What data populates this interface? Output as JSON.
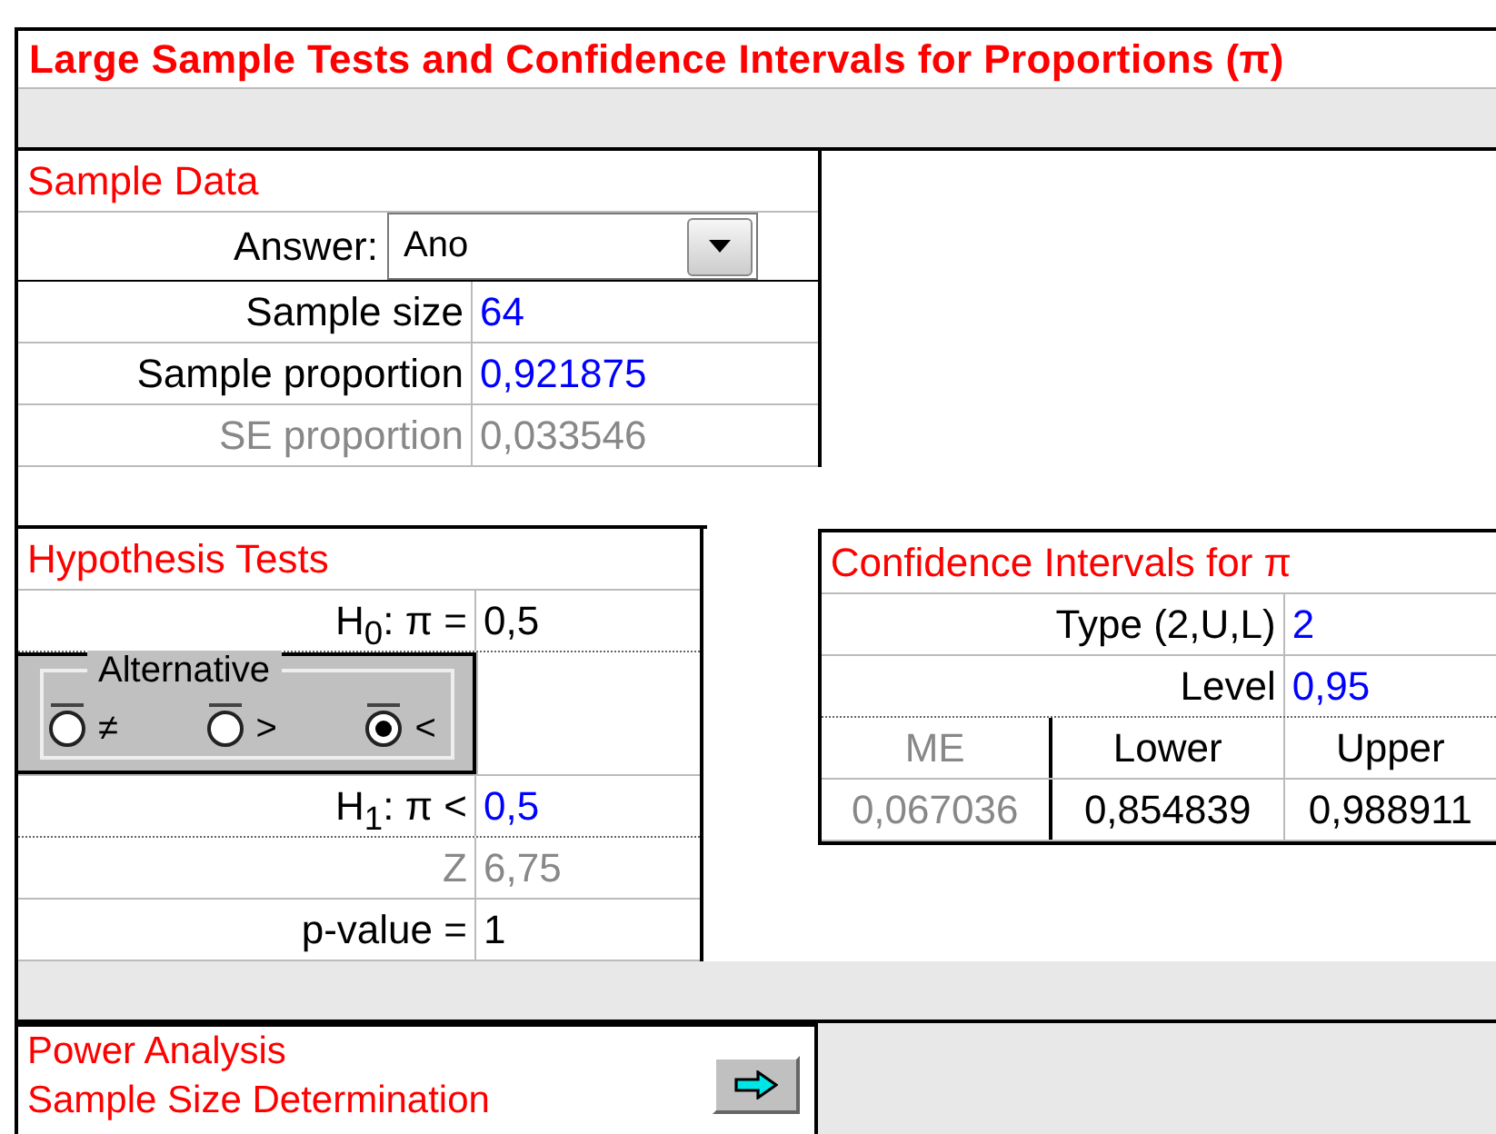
{
  "title": "Large Sample Tests and Confidence Intervals for Proportions (π)",
  "sample_data": {
    "heading": "Sample Data",
    "answer": {
      "label": "Answer:",
      "value": "Ano"
    },
    "rows": [
      {
        "label": "Sample size",
        "value": "64",
        "kind": "input"
      },
      {
        "label": "Sample proportion",
        "value": "0,921875",
        "kind": "input"
      },
      {
        "label": "SE proportion",
        "value": "0,033546",
        "kind": "computed"
      }
    ]
  },
  "hypothesis_tests": {
    "heading": "Hypothesis Tests",
    "h0": {
      "label": "H$_{0}$: π =",
      "value": "0,5"
    },
    "alternative": {
      "label": "Alternative",
      "options": [
        {
          "symbol": "≠",
          "selected": false
        },
        {
          "symbol": ">",
          "selected": false
        },
        {
          "symbol": "<",
          "selected": true
        }
      ]
    },
    "rows": [
      {
        "label": "H$_{1}$: π <",
        "value": "0,5",
        "kind": "input"
      },
      {
        "label": "Z",
        "value": "6,75",
        "kind": "computed"
      },
      {
        "label": "p-value =",
        "value": "1",
        "kind": "plain"
      }
    ]
  },
  "confidence_intervals": {
    "heading": "Confidence Intervals for π",
    "rows": [
      {
        "label": "Type (2,U,L)",
        "value": "2",
        "kind": "input"
      },
      {
        "label": "Level",
        "value": "0,95",
        "kind": "input"
      }
    ],
    "columns": [
      {
        "label": "ME",
        "kind": "computed"
      },
      {
        "label": "Lower",
        "kind": "plain"
      },
      {
        "label": "Upper",
        "kind": "plain"
      }
    ],
    "values": [
      "0,067036",
      "0,854839",
      "0,988911"
    ]
  },
  "power": {
    "lines": [
      "Power Analysis",
      "Sample Size Determination"
    ]
  }
}
